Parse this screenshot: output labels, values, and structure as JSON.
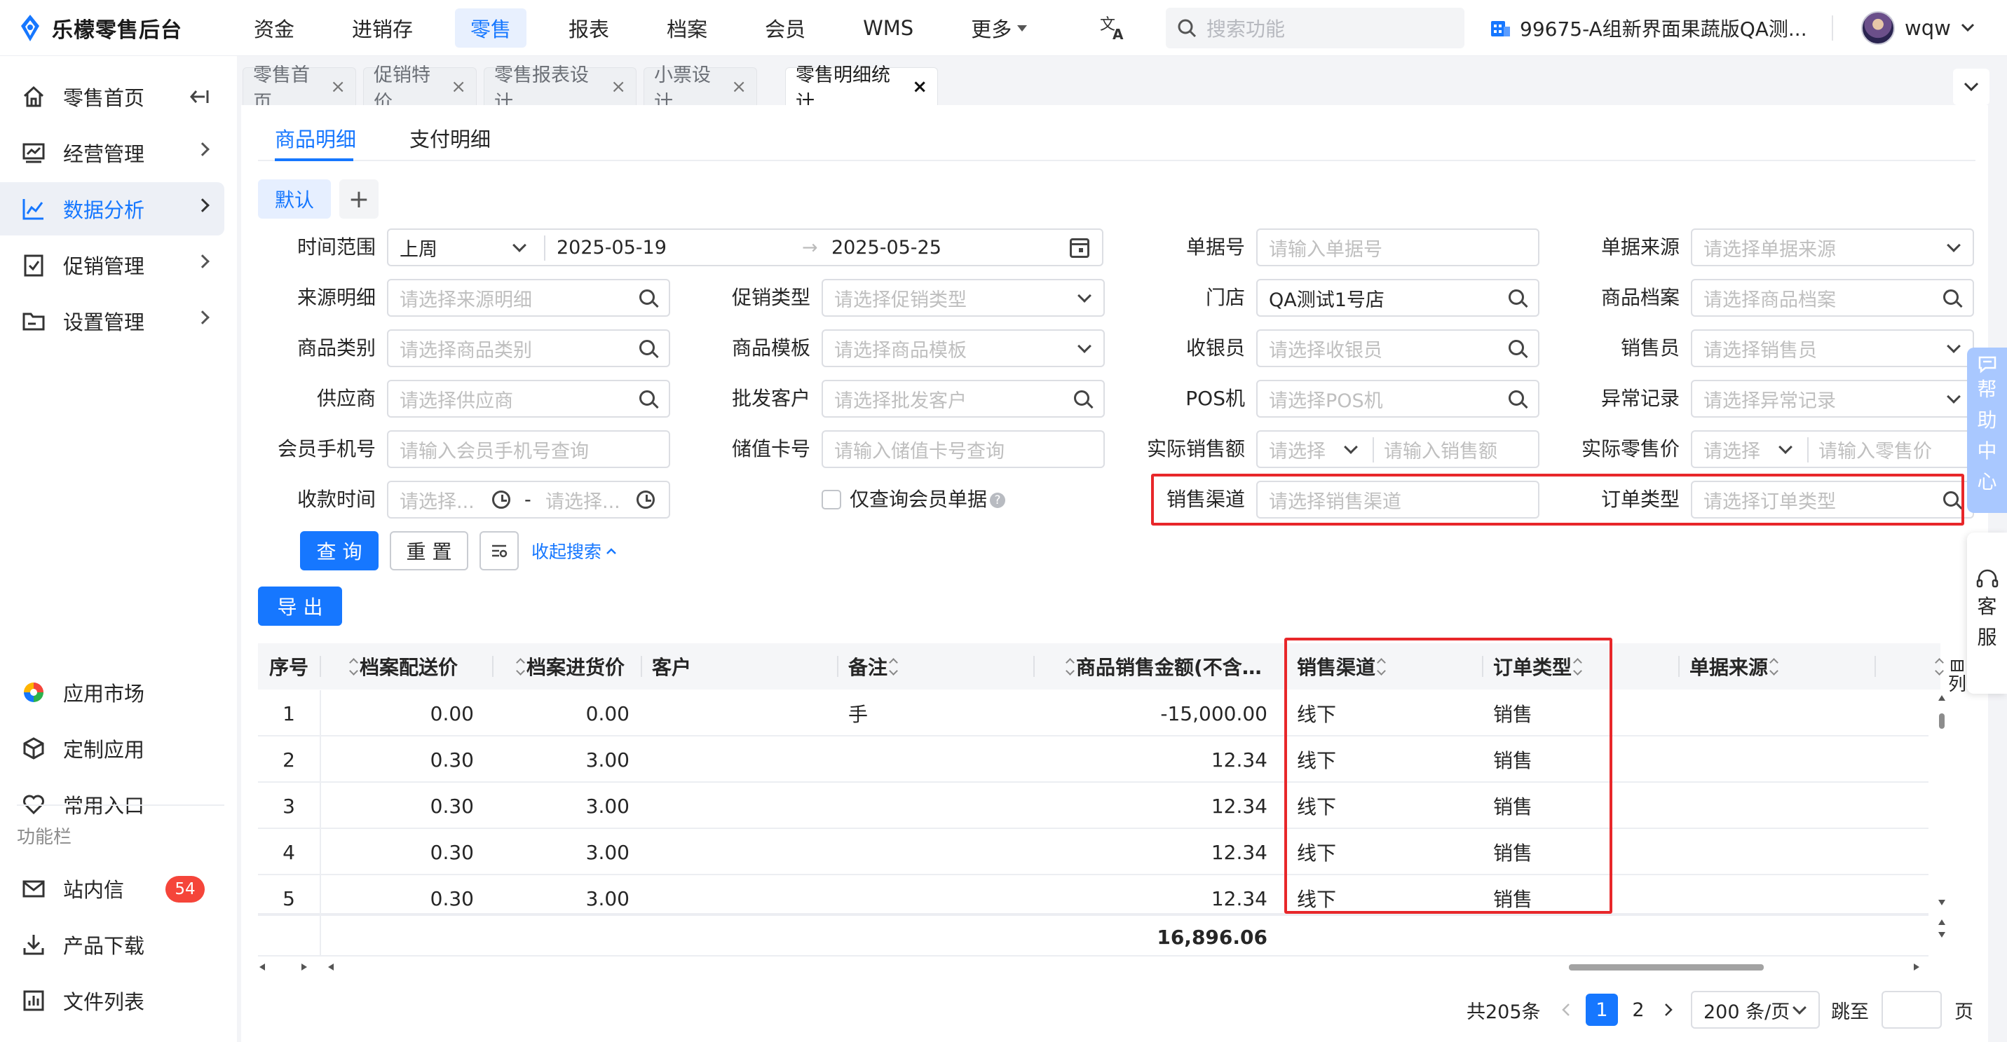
{
  "app": {
    "logo_text": "乐檬零售后台"
  },
  "top_nav": [
    {
      "label": "资金",
      "active": false
    },
    {
      "label": "进销存",
      "active": false
    },
    {
      "label": "零售",
      "active": true
    },
    {
      "label": "报表",
      "active": false
    },
    {
      "label": "档案",
      "active": false
    },
    {
      "label": "会员",
      "active": false
    },
    {
      "label": "WMS",
      "active": false
    },
    {
      "label": "更多",
      "active": false
    }
  ],
  "search": {
    "placeholder": "搜索功能"
  },
  "store": {
    "name": "99675-A组新界面果蔬版QA测..."
  },
  "user": {
    "name": "wqw"
  },
  "sidebar": {
    "items": [
      {
        "label": "零售首页"
      },
      {
        "label": "经营管理"
      },
      {
        "label": "数据分析"
      },
      {
        "label": "促销管理"
      },
      {
        "label": "设置管理"
      }
    ],
    "bottom": [
      {
        "label": "应用市场"
      },
      {
        "label": "定制应用"
      },
      {
        "label": "常用入口"
      }
    ],
    "group_label": "功能栏",
    "extras": [
      {
        "label": "站内信",
        "badge": "54"
      },
      {
        "label": "产品下载"
      },
      {
        "label": "文件列表"
      }
    ]
  },
  "page_tabs": [
    {
      "label": "零售首页"
    },
    {
      "label": "促销特价"
    },
    {
      "label": "零售报表设计"
    },
    {
      "label": "小票设计"
    },
    {
      "label": "零售明细统计"
    }
  ],
  "tab_close": "×",
  "sub_tabs": [
    {
      "label": "商品明细"
    },
    {
      "label": "支付明细"
    }
  ],
  "preset": {
    "label": "默认",
    "add": "+"
  },
  "filters": {
    "time_range": {
      "label": "时间范围",
      "value": "上周",
      "start": "2025-05-19",
      "end": "2025-05-25",
      "arrow": "→"
    },
    "doc_no": {
      "label": "单据号",
      "placeholder": "请输入单据号"
    },
    "doc_source": {
      "label": "单据来源",
      "placeholder": "请选择单据来源"
    },
    "source_detail": {
      "label": "来源明细",
      "placeholder": "请选择来源明细"
    },
    "promo_type": {
      "label": "促销类型",
      "placeholder": "请选择促销类型"
    },
    "store": {
      "label": "门店",
      "value": "QA测试1号店"
    },
    "product_file": {
      "label": "商品档案",
      "placeholder": "请选择商品档案"
    },
    "category": {
      "label": "商品类别",
      "placeholder": "请选择商品类别"
    },
    "template": {
      "label": "商品模板",
      "placeholder": "请选择商品模板"
    },
    "cashier": {
      "label": "收银员",
      "placeholder": "请选择收银员"
    },
    "salesperson": {
      "label": "销售员",
      "placeholder": "请选择销售员"
    },
    "supplier": {
      "label": "供应商",
      "placeholder": "请选择供应商"
    },
    "wholesale": {
      "label": "批发客户",
      "placeholder": "请选择批发客户"
    },
    "pos": {
      "label": "POS机",
      "placeholder": "请选择POS机"
    },
    "abnormal": {
      "label": "异常记录",
      "placeholder": "请选择异常记录"
    },
    "member_phone": {
      "label": "会员手机号",
      "placeholder": "请输入会员手机号查询"
    },
    "stored_card": {
      "label": "储值卡号",
      "placeholder": "请输入储值卡号查询"
    },
    "actual_sales": {
      "label": "实际销售额",
      "op_placeholder": "请选择",
      "placeholder": "请输入销售额"
    },
    "actual_price": {
      "label": "实际零售价",
      "op_placeholder": "请选择",
      "placeholder": "请输入零售价"
    },
    "pay_time": {
      "label": "收款时间",
      "start_placeholder": "请选择...",
      "end_placeholder": "请选择...",
      "dash": "-"
    },
    "member_only": {
      "label": "仅查询会员单据",
      "help": "?"
    },
    "channel": {
      "label": "销售渠道",
      "placeholder": "请选择销售渠道"
    },
    "order_type": {
      "label": "订单类型",
      "placeholder": "请选择订单类型"
    }
  },
  "actions": {
    "query": "查 询",
    "reset": "重 置",
    "collapse": "收起搜索",
    "export": "导 出"
  },
  "table": {
    "columns": [
      "序号",
      "档案配送价",
      "档案进货价",
      "客户",
      "备注",
      "商品销售金额(不含…",
      "销售渠道",
      "订单类型",
      "单据来源"
    ],
    "rows": [
      {
        "no": "1",
        "dist_price": "0.00",
        "purchase_price": "0.00",
        "customer": "",
        "remark": "手",
        "amount": "-15,000.00",
        "channel": "线下",
        "order_type": "销售",
        "source": ""
      },
      {
        "no": "2",
        "dist_price": "0.30",
        "purchase_price": "3.00",
        "customer": "",
        "remark": "",
        "amount": "12.34",
        "channel": "线下",
        "order_type": "销售",
        "source": ""
      },
      {
        "no": "3",
        "dist_price": "0.30",
        "purchase_price": "3.00",
        "customer": "",
        "remark": "",
        "amount": "12.34",
        "channel": "线下",
        "order_type": "销售",
        "source": ""
      },
      {
        "no": "4",
        "dist_price": "0.30",
        "purchase_price": "3.00",
        "customer": "",
        "remark": "",
        "amount": "12.34",
        "channel": "线下",
        "order_type": "销售",
        "source": ""
      },
      {
        "no": "5",
        "dist_price": "0.30",
        "purchase_price": "3.00",
        "customer": "",
        "remark": "",
        "amount": "12.34",
        "channel": "线下",
        "order_type": "销售",
        "source": ""
      }
    ],
    "total": "16,896.06"
  },
  "pagination": {
    "total": "共205条",
    "pages": [
      "1",
      "2"
    ],
    "current": "1",
    "page_size": "200 条/页",
    "goto": "跳至",
    "page_suffix": "页"
  },
  "side": {
    "help": [
      "帮",
      "助",
      "中",
      "心"
    ],
    "service": [
      "客",
      "服"
    ],
    "column_setting": "列"
  },
  "colors": {
    "primary": "#1677ff",
    "highlight": "#e8272a",
    "badge": "#f5453a"
  }
}
